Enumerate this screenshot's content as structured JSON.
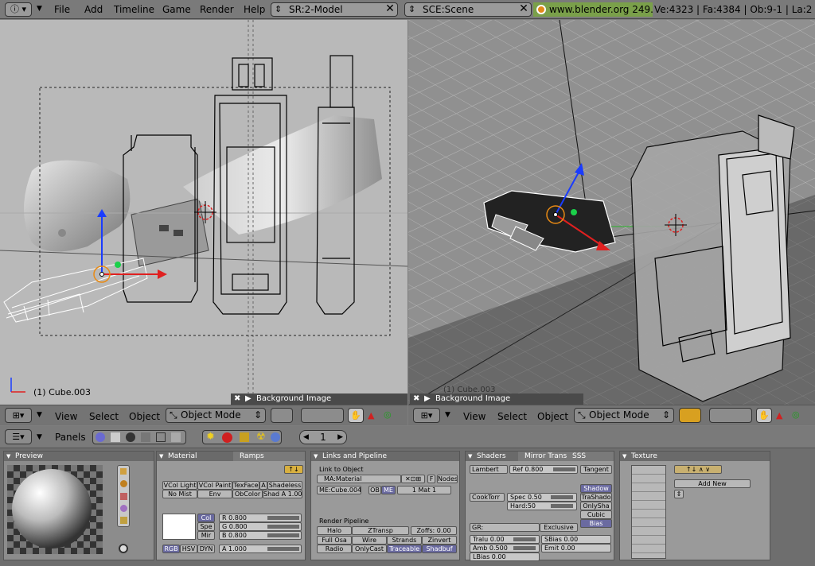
{
  "menu": [
    "File",
    "Add",
    "Timeline",
    "Game",
    "Render",
    "Help"
  ],
  "screen_field": "SR:2-Model",
  "scene_field": "SCE:Scene",
  "url": "www.blender.org 249.2",
  "stats": "Ve:4323 | Fa:4384 | Ob:9-1 | La:2",
  "left_viewport": {
    "object_label": "(1) Cube.003",
    "bg_label": "Background Image"
  },
  "right_viewport": {
    "bg_label": "Background Image",
    "obj_overlay": "(1) Cube.003"
  },
  "vp_header": {
    "view": "View",
    "select": "Select",
    "object": "Object",
    "mode": "Object Mode"
  },
  "buttons_header": {
    "panels": "Panels",
    "frame": "1"
  },
  "preview": {
    "title": "Preview"
  },
  "material": {
    "tab1": "Material",
    "tab2": "Ramps",
    "row1": [
      "VCol Light",
      "VCol Paint",
      "TexFace",
      "A",
      "Shadeless"
    ],
    "row2": [
      "No Mist",
      "Env",
      "ObColor",
      "Shad A 1.00"
    ],
    "col": "Col",
    "spe": "Spe",
    "mir": "Mir",
    "r": "R 0.800",
    "g": "G 0.800",
    "b": "B 0.800",
    "rgb": "RGB",
    "hsv": "HSV",
    "dyn": "DYN",
    "a": "A 1.000"
  },
  "links": {
    "title": "Links and Pipeline",
    "link_obj": "Link to Object",
    "ma": "MA:Material",
    "f": "F",
    "node": "Nodes",
    "me": "ME:Cube.004",
    "ob": "OB",
    "me2": "ME",
    "mat": "1 Mat 1",
    "pipeline": "Render Pipeline",
    "row1": [
      "Halo",
      "ZTransp",
      "Zoffs: 0.00"
    ],
    "row2": [
      "Full Osa",
      "Wire",
      "Strands",
      "Zinvert"
    ],
    "row3": [
      "Radio",
      "OnlyCast",
      "Traceable",
      "Shadbuf"
    ]
  },
  "shaders": {
    "tab1": "Shaders",
    "tab2": "Mirror Trans",
    "tab3": "SSS",
    "lambert": "Lambert",
    "ref": "Ref 0.800",
    "tangent": "Tangent",
    "shadow": "Shadow",
    "trashado": "TraShado",
    "onlysha": "OnlySha",
    "cubic": "Cubic",
    "bias": "Bias",
    "cooktorr": "CookTorr",
    "spec": "Spec 0.50",
    "hard": "Hard:50",
    "gr": "GR:",
    "exclusive": "Exclusive",
    "tralu": "Tralu 0.00",
    "sbias": "SBias 0.00",
    "amb": "Amb 0.500",
    "emit": "Emit 0.00",
    "lbias": "LBias 0.00"
  },
  "texture": {
    "title": "Texture",
    "add_new": "Add New"
  }
}
